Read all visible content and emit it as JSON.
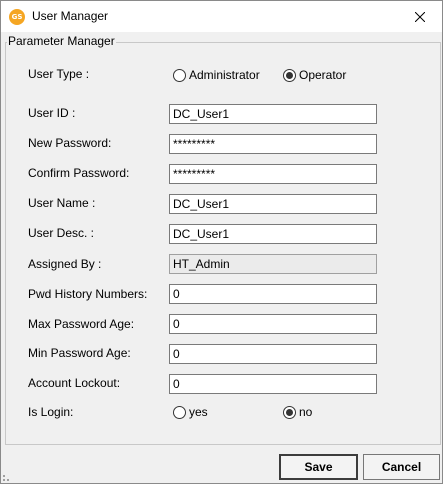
{
  "window": {
    "title": "User Manager",
    "icon_text": "GS"
  },
  "group": {
    "title": "Parameter Manager"
  },
  "user_type": {
    "label": "User Type :",
    "options": [
      {
        "label": "Administrator",
        "checked": false
      },
      {
        "label": "Operator",
        "checked": true
      }
    ]
  },
  "fields": {
    "user_id": {
      "label": "User ID :",
      "value": "DC_User1"
    },
    "new_password": {
      "label": "New Password:",
      "value": "*********"
    },
    "confirm_password": {
      "label": "Confirm Password:",
      "value": "*********"
    },
    "user_name": {
      "label": "User Name :",
      "value": "DC_User1"
    },
    "user_desc": {
      "label": "User Desc. :",
      "value": "DC_User1"
    },
    "assigned_by": {
      "label": "Assigned By :",
      "value": "HT_Admin"
    },
    "pwd_history": {
      "label": "Pwd History Numbers:",
      "value": "0"
    },
    "max_pwd_age": {
      "label": "Max Password Age:",
      "value": "0"
    },
    "min_pwd_age": {
      "label": "Min Password Age:",
      "value": "0"
    },
    "account_lockout": {
      "label": "Account Lockout:",
      "value": "0"
    }
  },
  "is_login": {
    "label": "Is Login:",
    "options": [
      {
        "label": "yes",
        "checked": false
      },
      {
        "label": "no",
        "checked": true
      }
    ]
  },
  "buttons": {
    "save": "Save",
    "cancel": "Cancel"
  },
  "icons": {
    "app": "app-logo-icon",
    "close": "close-icon"
  },
  "colors": {
    "app_icon": "#f5a623",
    "window_bg": "#f0f0f0"
  }
}
